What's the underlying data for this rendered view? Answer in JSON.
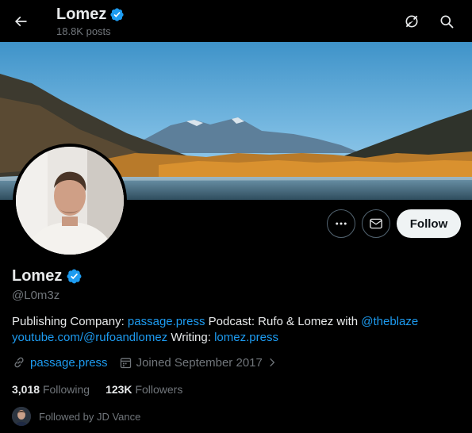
{
  "header": {
    "name": "Lomez",
    "posts": "18.8K posts"
  },
  "profile": {
    "name": "Lomez",
    "handle": "@L0m3z",
    "bio": {
      "p1": "Publishing Company: ",
      "link1": "passage.press",
      "p2": "  Podcast: Rufo & Lomez with ",
      "link2": "@theblaze",
      "link3": "youtube.com/@rufoandlomez",
      "p3": "  Writing: ",
      "link4": "lomez.press"
    },
    "website": "passage.press",
    "joined": "Joined September 2017",
    "following_count": "3,018",
    "following_label": "Following",
    "followers_count": "123K",
    "followers_label": "Followers",
    "followed_by": "Followed by JD Vance"
  },
  "actions": {
    "follow_label": "Follow"
  },
  "colors": {
    "accent": "#1d9bf0",
    "verified": "#1d9bf0",
    "muted": "#71767b"
  },
  "icons": [
    "back-arrow-icon",
    "verified-badge-icon",
    "grok-icon",
    "search-icon",
    "more-icon",
    "message-icon",
    "link-icon",
    "calendar-icon",
    "chevron-right-icon"
  ]
}
